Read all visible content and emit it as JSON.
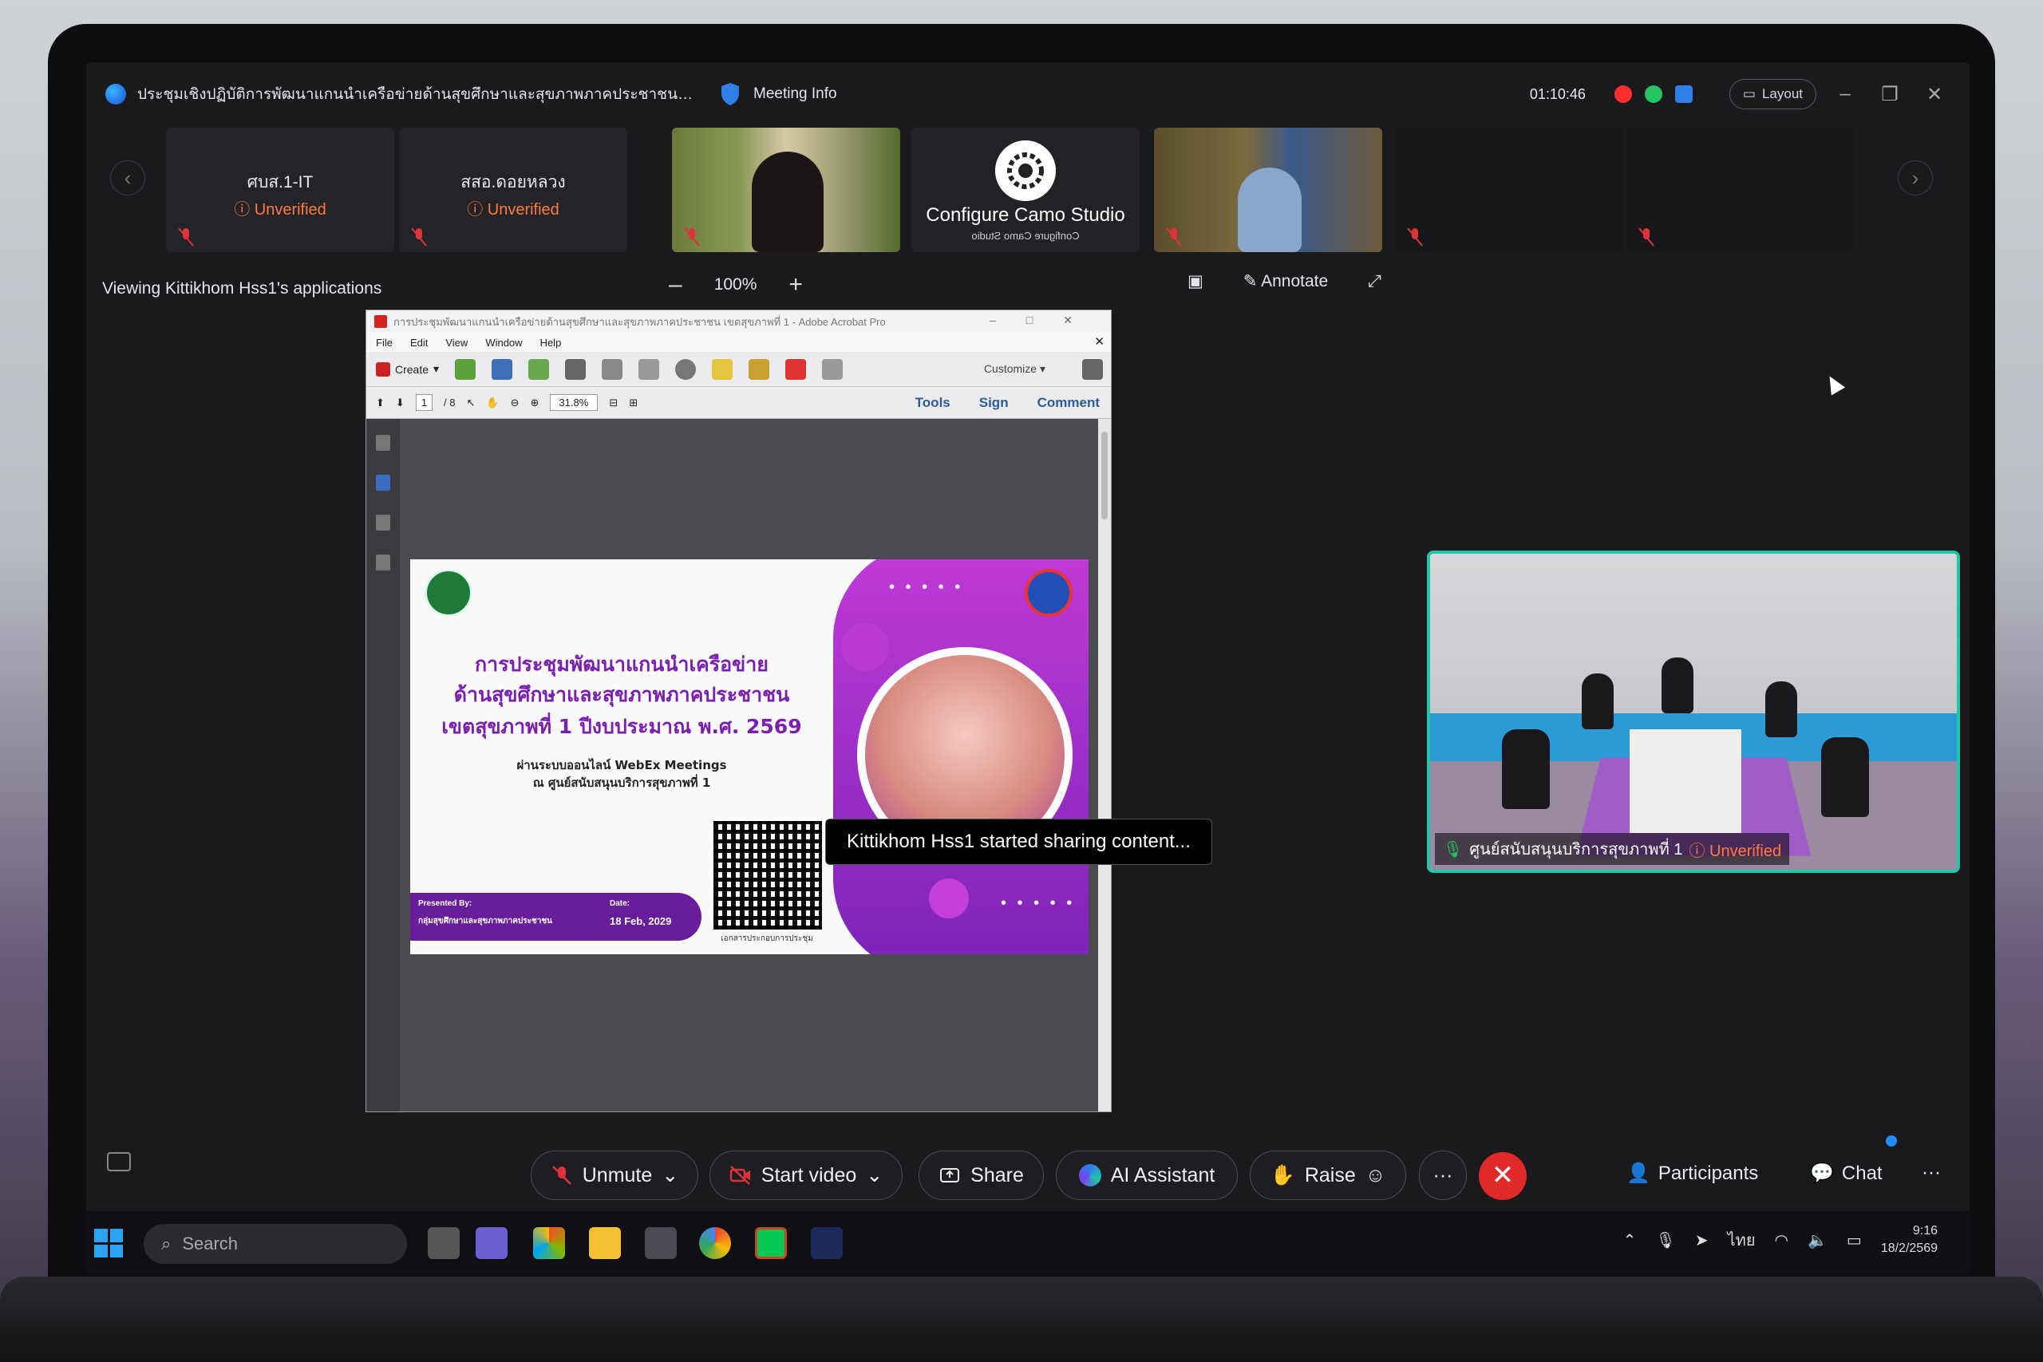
{
  "window": {
    "title": "ประชุมเชิงปฏิบัติการพัฒนาแกนนำเครือข่ายด้านสุขศึกษาและสุขภาพภาคประชาชน (...",
    "meeting_info": "Meeting Info",
    "timer": "01:10:46",
    "layout_label": "Layout",
    "colors": {
      "record": "#ff2d2d",
      "audio": "#22c55e",
      "accent": "#1fc6a8"
    }
  },
  "participants": [
    {
      "name": "ศบส.1-IT",
      "status": "Unverified"
    },
    {
      "name": "สสอ.ดอยหลวง",
      "status": "Unverified"
    },
    {
      "name": "",
      "status": ""
    },
    {
      "name": "Configure Camo Studio",
      "mirror": "Configure Camo Studio"
    },
    {
      "name": "",
      "status": ""
    }
  ],
  "share_bar": {
    "viewing": "Viewing Kittikhom Hss1's applications",
    "zoom": "100%",
    "annotate": "Annotate"
  },
  "acrobat": {
    "title": "การประชุมพัฒนาแกนนำเครือข่ายด้านสุขศึกษาและสุขภาพภาคประชาชน เขตสุขภาพที่ 1 - Adobe Acrobat Pro",
    "menu": [
      "File",
      "Edit",
      "View",
      "Window",
      "Help"
    ],
    "create": "Create",
    "customize": "Customize",
    "page_current": "1",
    "page_total": "/ 8",
    "zoom": "31.8%",
    "tabs": [
      "Tools",
      "Sign",
      "Comment"
    ]
  },
  "slide": {
    "line1": "การประชุมพัฒนาแกนนำเครือข่าย",
    "line2": "ด้านสุขศึกษาและสุขภาพภาคประชาชน",
    "line3": "เขตสุขภาพที่ 1 ปีงบประมาณ พ.ศ. 2569",
    "sub1": "ผ่านระบบออนไลน์ WebEx Meetings",
    "sub2": "ณ ศูนย์สนับสนุนบริการสุขภาพที่ 1",
    "presented_label": "Presented By:",
    "presented_value": "กลุ่มสุขศึกษาและสุขภาพภาคประชาชน",
    "date_label": "Date:",
    "date_value": "18 Feb, 2029",
    "qr_caption": "เอกสารประกอบการประชุม"
  },
  "toast": "Kittikhom Hss1 started sharing content...",
  "self_view": {
    "name": "ศูนย์สนับสนุนบริการสุขภาพที่ 1",
    "status": "Unverified"
  },
  "controls": {
    "unmute": "Unmute",
    "start_video": "Start video",
    "share": "Share",
    "ai_assistant": "AI Assistant",
    "raise": "Raise",
    "more": "···",
    "participants": "Participants",
    "chat": "Chat"
  },
  "taskbar": {
    "search": "Search",
    "lang": "ไทย",
    "time": "9:16",
    "date": "18/2/2569"
  }
}
